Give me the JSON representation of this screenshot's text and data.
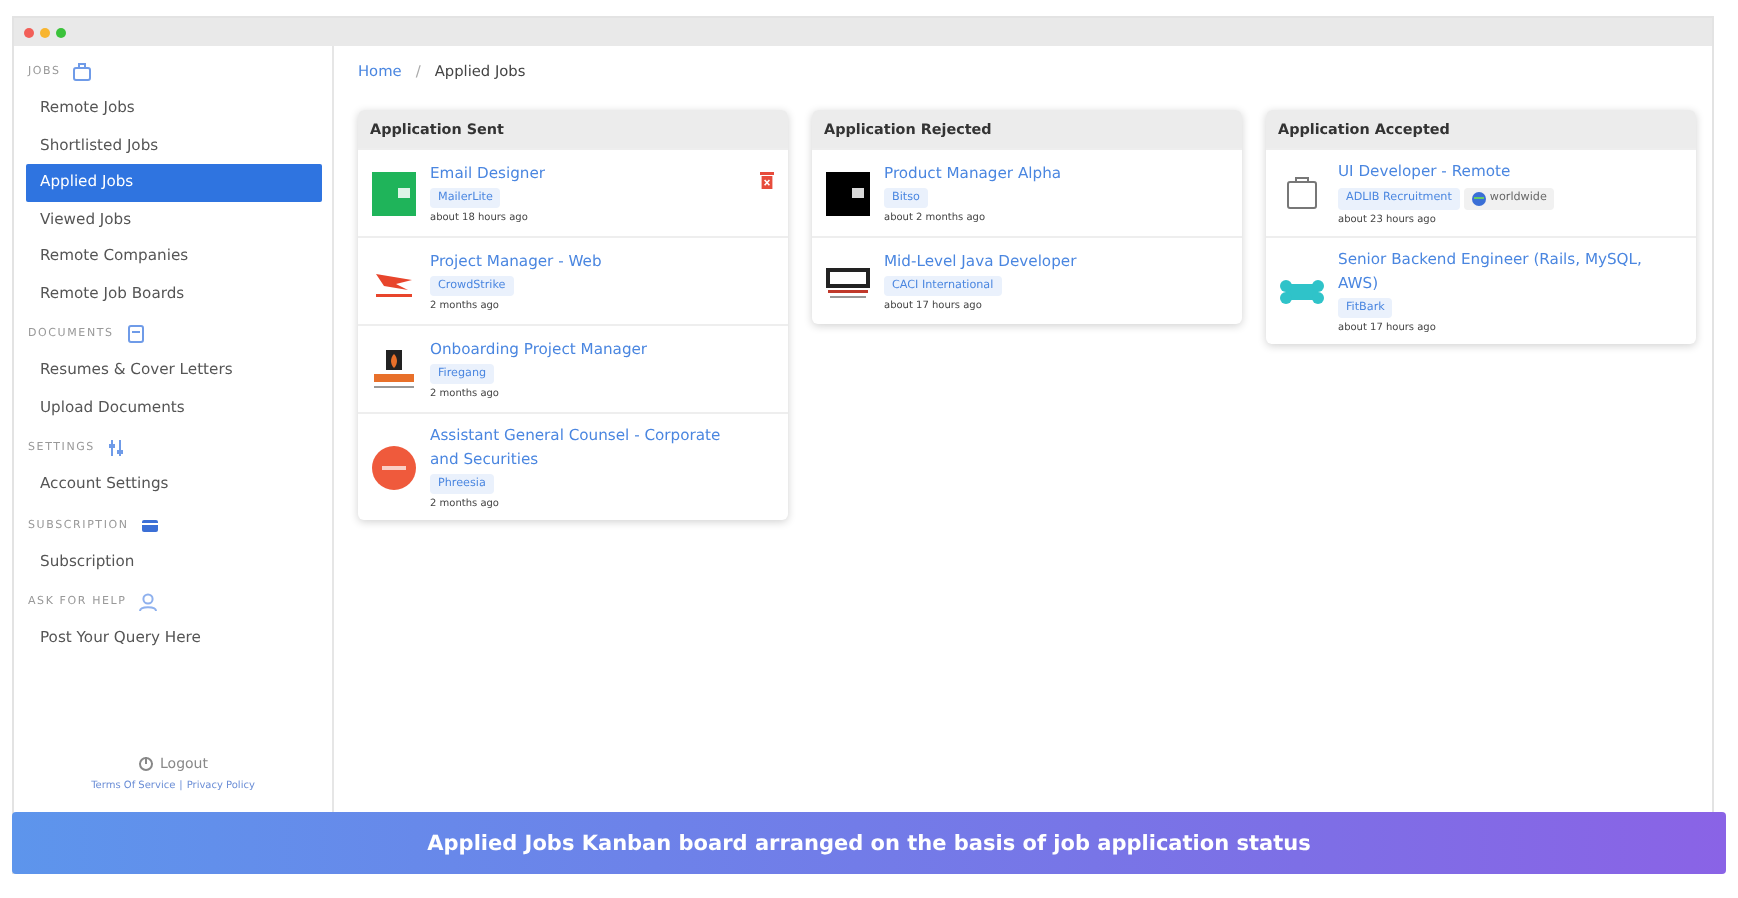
{
  "sidebar": {
    "sections": [
      {
        "heading": "JOBS",
        "items": [
          {
            "label": "Remote Jobs",
            "selected": false
          },
          {
            "label": "Shortlisted Jobs",
            "selected": false
          },
          {
            "label": "Applied Jobs",
            "selected": true
          },
          {
            "label": "Viewed Jobs",
            "selected": false
          },
          {
            "label": "Remote Companies",
            "selected": false
          },
          {
            "label": "Remote Job Boards",
            "selected": false
          }
        ]
      },
      {
        "heading": "DOCUMENTS",
        "items": [
          {
            "label": "Resumes & Cover Letters",
            "selected": false
          },
          {
            "label": "Upload Documents",
            "selected": false
          }
        ]
      },
      {
        "heading": "SETTINGS",
        "items": [
          {
            "label": "Account Settings",
            "selected": false
          }
        ]
      },
      {
        "heading": "SUBSCRIPTION",
        "items": [
          {
            "label": "Subscription",
            "selected": false
          }
        ]
      },
      {
        "heading": "ASK FOR HELP",
        "items": [
          {
            "label": "Post Your Query Here",
            "selected": false
          }
        ]
      }
    ],
    "logout": "Logout",
    "footer_links": [
      "Terms Of Service",
      "Privacy Policy"
    ],
    "footer_separator": "|"
  },
  "breadcrumb": {
    "items": [
      "Home",
      "Applied Jobs"
    ],
    "separator": "/"
  },
  "columns": [
    {
      "title": "Application Sent",
      "cards": [
        {
          "title": "Email Designer",
          "company": "MailerLite",
          "time": "about 18 hours ago",
          "hovered": true,
          "logo": {
            "kind": "square",
            "color": "#1fb45a"
          }
        },
        {
          "title": "Project Manager - Web",
          "company": "CrowdStrike",
          "time": "2 months ago",
          "hovered": false,
          "logo": {
            "kind": "bird",
            "color": "#e8452c"
          }
        },
        {
          "title": "Onboarding Project Manager",
          "company": "Firegang",
          "time": "2 months ago",
          "hovered": false,
          "logo": {
            "kind": "flame",
            "color": "#e8702a"
          }
        },
        {
          "title": "Assistant General Counsel - Corporate and Securities",
          "company": "Phreesia",
          "time": "2 months ago",
          "hovered": false,
          "logo": {
            "kind": "circle",
            "color": "#ef5a3c"
          }
        }
      ]
    },
    {
      "title": "Application Rejected",
      "cards": [
        {
          "title": "Product Manager Alpha",
          "company": "Bitso",
          "time": "about 2 months ago",
          "hovered": false,
          "logo": {
            "kind": "square",
            "color": "#000000"
          }
        },
        {
          "title": "Mid-Level Java Developer",
          "company": "CACI International",
          "time": "about 17 hours ago",
          "hovered": false,
          "logo": {
            "kind": "wordmark",
            "color": "#222222"
          }
        }
      ]
    },
    {
      "title": "Application Accepted",
      "cards": [
        {
          "title": "UI Developer - Remote",
          "company": "ADLIB Recruitment",
          "location": "worldwide",
          "time": "about 23 hours ago",
          "hovered": false,
          "logo": {
            "kind": "briefcase",
            "color": "#777777"
          }
        },
        {
          "title": "Senior Backend Engineer (Rails, MySQL, AWS)",
          "company": "FitBark",
          "time": "about 17 hours ago",
          "hovered": false,
          "logo": {
            "kind": "bone",
            "color": "#2fc3c9"
          }
        }
      ]
    }
  ],
  "caption": "Applied Jobs Kanban board arranged on the basis of job application status"
}
